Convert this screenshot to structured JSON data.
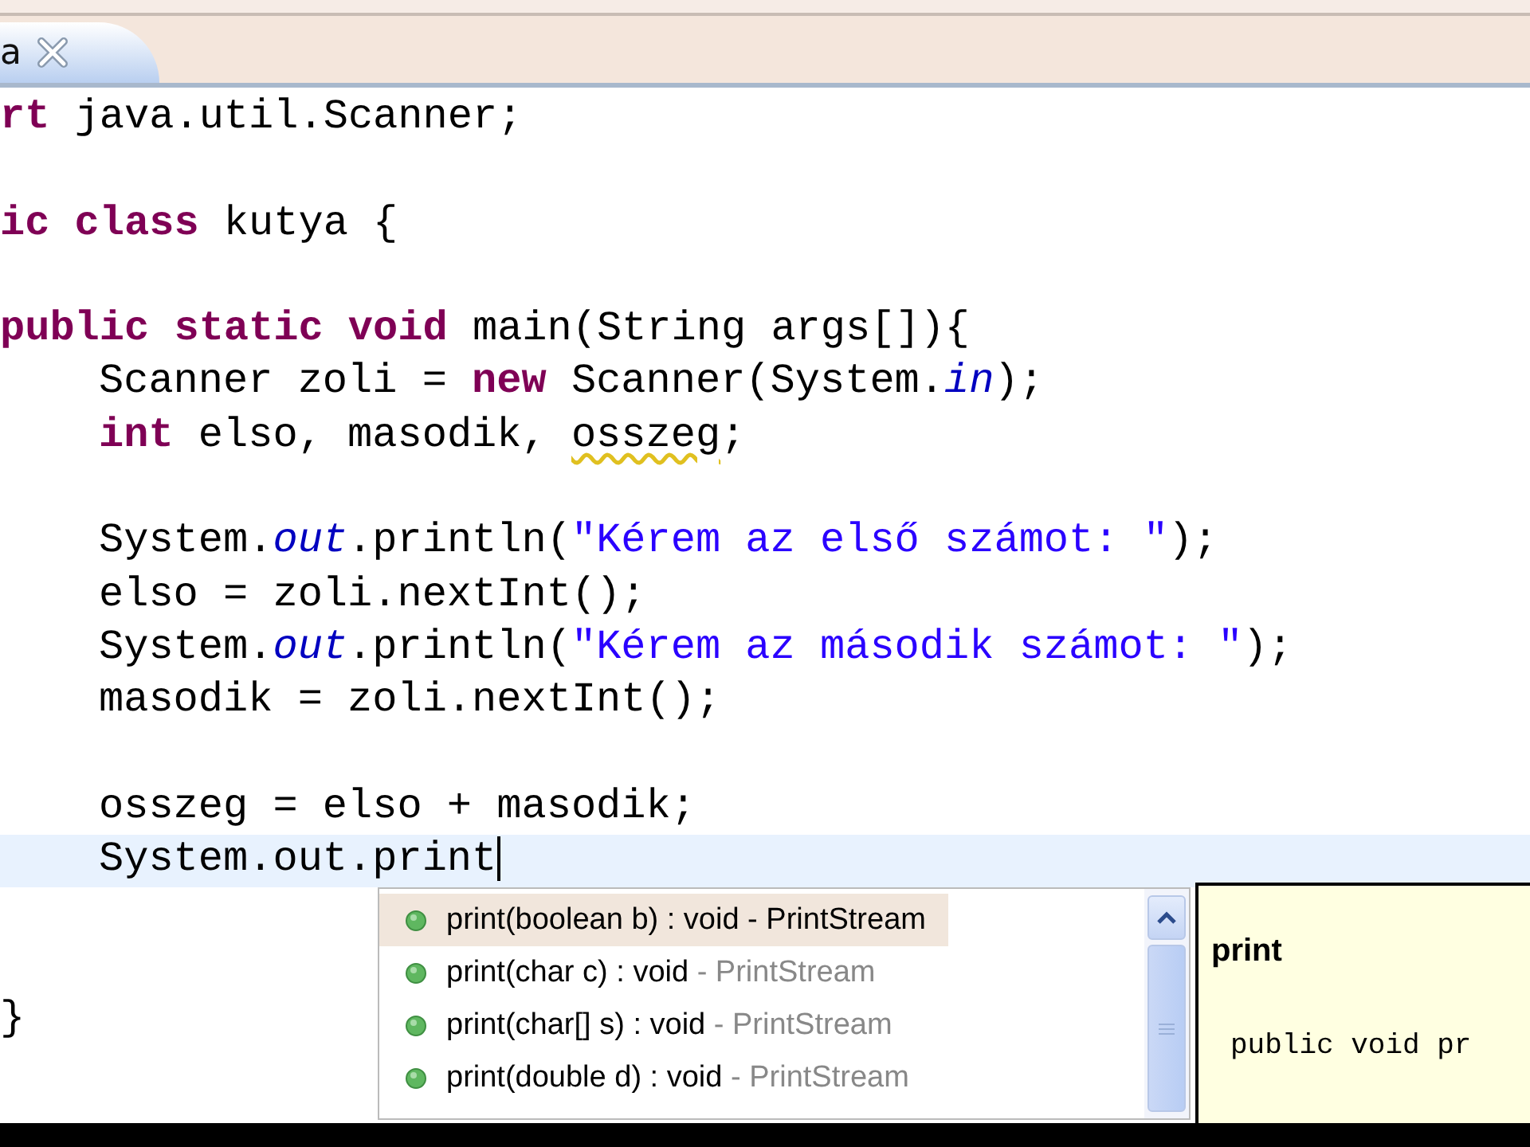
{
  "tab": {
    "label": "a",
    "selected": true
  },
  "lines": [
    {
      "kind": "declaration",
      "tokens": [
        {
          "kind": "keyword",
          "text": "rt"
        },
        {
          "kind": "plain",
          "text": " java.util.Scanner;"
        }
      ]
    },
    {
      "kind": "blank"
    },
    {
      "kind": "declaration",
      "tokens": [
        {
          "kind": "keyword",
          "text": "ic class"
        },
        {
          "kind": "plain",
          "text": " kutya {"
        }
      ]
    },
    {
      "kind": "blank"
    },
    {
      "kind": "declaration",
      "tokens": [
        {
          "kind": "keyword",
          "text": "public static void"
        },
        {
          "kind": "plain",
          "text": " main(String args[]){"
        }
      ]
    },
    {
      "kind": "statement",
      "tokens": [
        {
          "kind": "plain",
          "text": "Scanner zoli = "
        },
        {
          "kind": "keyword",
          "text": "new"
        },
        {
          "kind": "plain",
          "text": " Scanner(System."
        },
        {
          "kind": "static_field",
          "text": "in"
        },
        {
          "kind": "plain",
          "text": ");"
        }
      ]
    },
    {
      "kind": "statement",
      "tokens": [
        {
          "kind": "keyword",
          "text": "int"
        },
        {
          "kind": "plain",
          "text": " elso, masodik, "
        },
        {
          "kind": "plain",
          "text": "osszeg",
          "warning": true
        },
        {
          "kind": "plain",
          "text": ";"
        }
      ]
    },
    {
      "kind": "blank"
    },
    {
      "kind": "statement",
      "tokens": [
        {
          "kind": "plain",
          "text": "System."
        },
        {
          "kind": "static_field",
          "text": "out"
        },
        {
          "kind": "plain",
          "text": ".println("
        },
        {
          "kind": "string",
          "text": "\"Kérem az első számot: \""
        },
        {
          "kind": "plain",
          "text": ");"
        }
      ]
    },
    {
      "kind": "statement",
      "tokens": [
        {
          "kind": "plain",
          "text": "elso = zoli.nextInt();"
        }
      ]
    },
    {
      "kind": "statement",
      "tokens": [
        {
          "kind": "plain",
          "text": "System."
        },
        {
          "kind": "static_field",
          "text": "out"
        },
        {
          "kind": "plain",
          "text": ".println("
        },
        {
          "kind": "string",
          "text": "\"Kérem az második számot: \""
        },
        {
          "kind": "plain",
          "text": ");"
        }
      ]
    },
    {
      "kind": "statement",
      "tokens": [
        {
          "kind": "plain",
          "text": "masodik = zoli.nextInt();"
        }
      ]
    },
    {
      "kind": "blank"
    },
    {
      "kind": "statement",
      "tokens": [
        {
          "kind": "plain",
          "text": "osszeg = elso + masodik;"
        }
      ]
    },
    {
      "kind": "statement",
      "current": true,
      "tokens": [
        {
          "kind": "plain",
          "text": "System.out.print"
        }
      ]
    },
    {
      "kind": "blank"
    },
    {
      "kind": "blank"
    },
    {
      "kind": "declaration",
      "tokens": [
        {
          "kind": "plain",
          "text": "}"
        }
      ]
    }
  ],
  "completions": [
    {
      "signature": "print(boolean b) : void",
      "type": "- PrintStream",
      "selected": true
    },
    {
      "signature": "print(char c) : void",
      "type": "- PrintStream",
      "selected": false
    },
    {
      "signature": "print(char[] s) : void",
      "type": "- PrintStream",
      "selected": false
    },
    {
      "signature": "print(double d) : void",
      "type": "- PrintStream",
      "selected": false
    }
  ],
  "doc": {
    "title": "print",
    "code": "public void pr"
  }
}
